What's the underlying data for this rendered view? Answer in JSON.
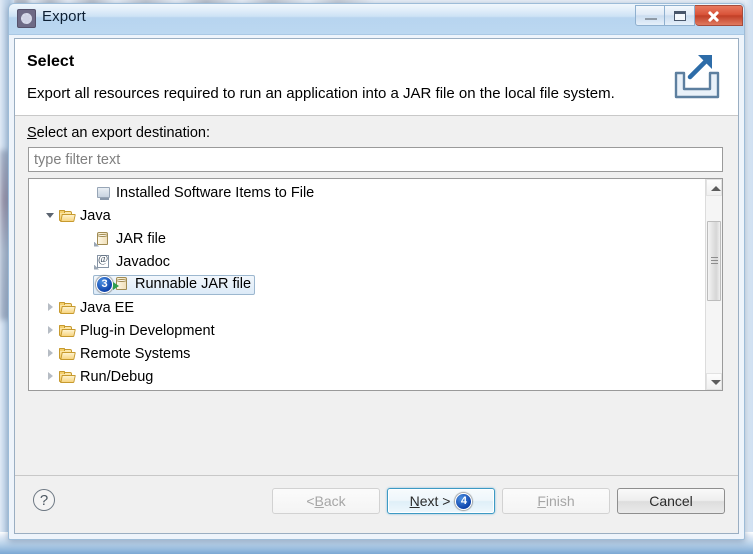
{
  "window": {
    "title": "Export",
    "icon": "export-wizard-icon",
    "controls": {
      "minimize": "minimize-button",
      "maximize": "maximize-button",
      "close": "close-button"
    }
  },
  "header": {
    "title": "Select",
    "description": "Export all resources required to run an application into a JAR file on the local file system.",
    "icon": "export-banner-icon"
  },
  "form": {
    "label_prefix": "S",
    "label_rest": "elect an export destination:",
    "filter": {
      "value": "",
      "placeholder": "type filter text"
    }
  },
  "tree": {
    "items": [
      {
        "label": "Installed Software Items to File",
        "indent": 2,
        "twisty": "none",
        "icon": "installed-software-icon",
        "selected": false,
        "badge": ""
      },
      {
        "label": "Java",
        "indent": 0,
        "twisty": "expanded",
        "icon": "folder-open-icon",
        "selected": false,
        "badge": ""
      },
      {
        "label": "JAR file",
        "indent": 2,
        "twisty": "none",
        "icon": "jar-file-icon",
        "selected": false,
        "badge": ""
      },
      {
        "label": "Javadoc",
        "indent": 2,
        "twisty": "none",
        "icon": "javadoc-icon",
        "selected": false,
        "badge": ""
      },
      {
        "label": "Runnable JAR file",
        "indent": 2,
        "twisty": "none",
        "icon": "runnable-jar-icon",
        "selected": true,
        "badge": "3"
      },
      {
        "label": "Java EE",
        "indent": 0,
        "twisty": "collapsed",
        "icon": "folder-icon",
        "selected": false,
        "badge": ""
      },
      {
        "label": "Plug-in Development",
        "indent": 0,
        "twisty": "collapsed",
        "icon": "folder-icon",
        "selected": false,
        "badge": ""
      },
      {
        "label": "Remote Systems",
        "indent": 0,
        "twisty": "collapsed",
        "icon": "folder-icon",
        "selected": false,
        "badge": ""
      },
      {
        "label": "Run/Debug",
        "indent": 0,
        "twisty": "collapsed",
        "icon": "folder-icon",
        "selected": false,
        "badge": ""
      }
    ],
    "scrollbar": {
      "up": "scroll-up-arrow",
      "down": "scroll-down-arrow",
      "thumb": "scroll-thumb"
    }
  },
  "footer": {
    "help": "?",
    "buttons": [
      {
        "name": "back-button",
        "prefix": "< ",
        "accel": "B",
        "suffix": "ack",
        "state": "disabled",
        "badge": ""
      },
      {
        "name": "next-button",
        "prefix": "",
        "accel": "N",
        "suffix": "ext >",
        "state": "focused",
        "badge": "4"
      },
      {
        "name": "finish-button",
        "prefix": "",
        "accel": "F",
        "suffix": "inish",
        "state": "disabled",
        "badge": ""
      },
      {
        "name": "cancel-button",
        "prefix": "",
        "accel": "",
        "suffix": "Cancel",
        "state": "enabled",
        "badge": ""
      }
    ]
  },
  "colors": {
    "titlebar": "#bcd8f1",
    "close_button": "#c23f27",
    "badge_blue": "#0b3fa8",
    "focus_ring": "#3d9ac4",
    "dialog_bg": "#f0f0f0"
  }
}
